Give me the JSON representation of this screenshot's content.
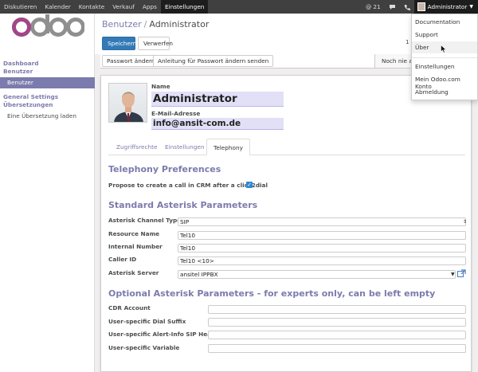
{
  "topbar": {
    "menu": [
      "Diskutieren",
      "Kalender",
      "Kontakte",
      "Verkauf",
      "Apps",
      "Einstellungen"
    ],
    "active_index": 5,
    "notification_count": "21",
    "user_name": "Administrator"
  },
  "sidebar": {
    "logo_text": "odoo",
    "sections": [
      {
        "title": "Dashboard"
      },
      {
        "title": "Benutzer",
        "items": [
          {
            "label": "Benutzer",
            "active": true
          }
        ]
      },
      {
        "title": "General Settings"
      },
      {
        "title": "Übersetzungen",
        "items": [
          {
            "label": "Eine Übersetzung laden",
            "active": false
          }
        ]
      }
    ]
  },
  "breadcrumb": {
    "parent": "Benutzer",
    "separator": "/",
    "current": "Administrator"
  },
  "buttons": {
    "save": "Speichern",
    "discard": "Verwerfen"
  },
  "pager": "1 /",
  "statusbar": {
    "buttons": [
      "Passwort ändern",
      "Anleitung für Passwort ändern senden"
    ],
    "stage": "Noch nie ang"
  },
  "user_form": {
    "name_label": "Name",
    "name_value": "Administrator",
    "email_label": "E-Mail-Adresse",
    "email_value": "info@ansit-com.de"
  },
  "tabs": [
    {
      "label": "Zugriffsrechte"
    },
    {
      "label": "Einstellungen"
    },
    {
      "label": "Telephony",
      "active": true
    }
  ],
  "telephony": {
    "title": "Telephony Preferences",
    "click2dial_label": "Propose to create a call in CRM after a click2dial",
    "click2dial_checked": true
  },
  "standard": {
    "title": "Standard Asterisk Parameters",
    "fields": [
      {
        "label": "Asterisk Channel Type",
        "value": "SIP"
      },
      {
        "label": "Resource Name",
        "value": "Tel10"
      },
      {
        "label": "Internal Number",
        "value": "Tel10"
      },
      {
        "label": "Caller ID",
        "value": "Tel10 <10>"
      },
      {
        "label": "Asterisk Server",
        "value": "ansitel IPPBX"
      }
    ]
  },
  "optional": {
    "title": "Optional Asterisk Parameters - for experts only, can be left empty",
    "fields": [
      {
        "label": "CDR Account",
        "value": ""
      },
      {
        "label": "User-specific Dial Suffix",
        "value": ""
      },
      {
        "label": "User-specific Alert-Info SIP Header",
        "value": ""
      },
      {
        "label": "User-specific Variable",
        "value": ""
      }
    ]
  },
  "user_menu": {
    "items": [
      "Documentation",
      "Support",
      "Über",
      "Einstellungen",
      "Mein Odoo.com Konto",
      "Abmeldung"
    ],
    "hover_index": 2
  },
  "colors": {
    "brand": "#7c7bad",
    "primary_button": "#337ab7",
    "topbar": "#404040"
  }
}
